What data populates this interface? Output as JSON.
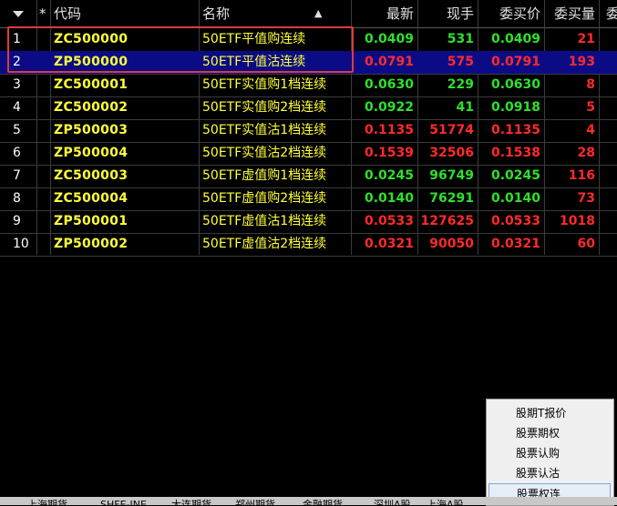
{
  "header": {
    "col_star": "*",
    "col_code": "代码",
    "col_name": "名称",
    "col_last": "最新",
    "col_vol": "现手",
    "col_bid": "委买价",
    "col_bidvol": "委买量",
    "col_more": "委"
  },
  "rows": [
    {
      "n": "1",
      "code": "ZC500000",
      "name": "50ETF平值购连续",
      "last": "0.0409",
      "vol": "531",
      "bid": "0.0409",
      "bidvol": "21",
      "dir": "up"
    },
    {
      "n": "2",
      "code": "ZP500000",
      "name": "50ETF平值沽连续",
      "last": "0.0791",
      "vol": "575",
      "bid": "0.0791",
      "bidvol": "193",
      "dir": "down"
    },
    {
      "n": "3",
      "code": "ZC500001",
      "name": "50ETF实值购1档连续",
      "last": "0.0630",
      "vol": "229",
      "bid": "0.0630",
      "bidvol": "8",
      "dir": "up"
    },
    {
      "n": "4",
      "code": "ZC500002",
      "name": "50ETF实值购2档连续",
      "last": "0.0922",
      "vol": "41",
      "bid": "0.0918",
      "bidvol": "5",
      "dir": "up"
    },
    {
      "n": "5",
      "code": "ZP500003",
      "name": "50ETF实值沽1档连续",
      "last": "0.1135",
      "vol": "51774",
      "bid": "0.1135",
      "bidvol": "4",
      "dir": "down"
    },
    {
      "n": "6",
      "code": "ZP500004",
      "name": "50ETF实值沽2档连续",
      "last": "0.1539",
      "vol": "32506",
      "bid": "0.1538",
      "bidvol": "28",
      "dir": "down"
    },
    {
      "n": "7",
      "code": "ZC500003",
      "name": "50ETF虚值购1档连续",
      "last": "0.0245",
      "vol": "96749",
      "bid": "0.0245",
      "bidvol": "116",
      "dir": "up"
    },
    {
      "n": "8",
      "code": "ZC500004",
      "name": "50ETF虚值购2档连续",
      "last": "0.0140",
      "vol": "76291",
      "bid": "0.0140",
      "bidvol": "73",
      "dir": "up"
    },
    {
      "n": "9",
      "code": "ZP500001",
      "name": "50ETF虚值沽1档连续",
      "last": "0.0533",
      "vol": "127625",
      "bid": "0.0533",
      "bidvol": "1018",
      "dir": "down"
    },
    {
      "n": "10",
      "code": "ZP500002",
      "name": "50ETF虚值沽2档连续",
      "last": "0.0321",
      "vol": "90050",
      "bid": "0.0321",
      "bidvol": "60",
      "dir": "down"
    }
  ],
  "menu": {
    "items": [
      "股期T报价",
      "股票期权",
      "股票认购",
      "股票认沽",
      "股票权连"
    ],
    "highlighted": 4
  },
  "tabs": [
    "上海期货",
    "SHFE-INE",
    "大连期货",
    "郑州期货",
    "金融期货",
    "深圳A股",
    "上海A股"
  ],
  "colors": {
    "up": "#2ee02e",
    "down": "#ff2a2a",
    "code": "#ffff3a",
    "selected": "#0b0b86"
  }
}
